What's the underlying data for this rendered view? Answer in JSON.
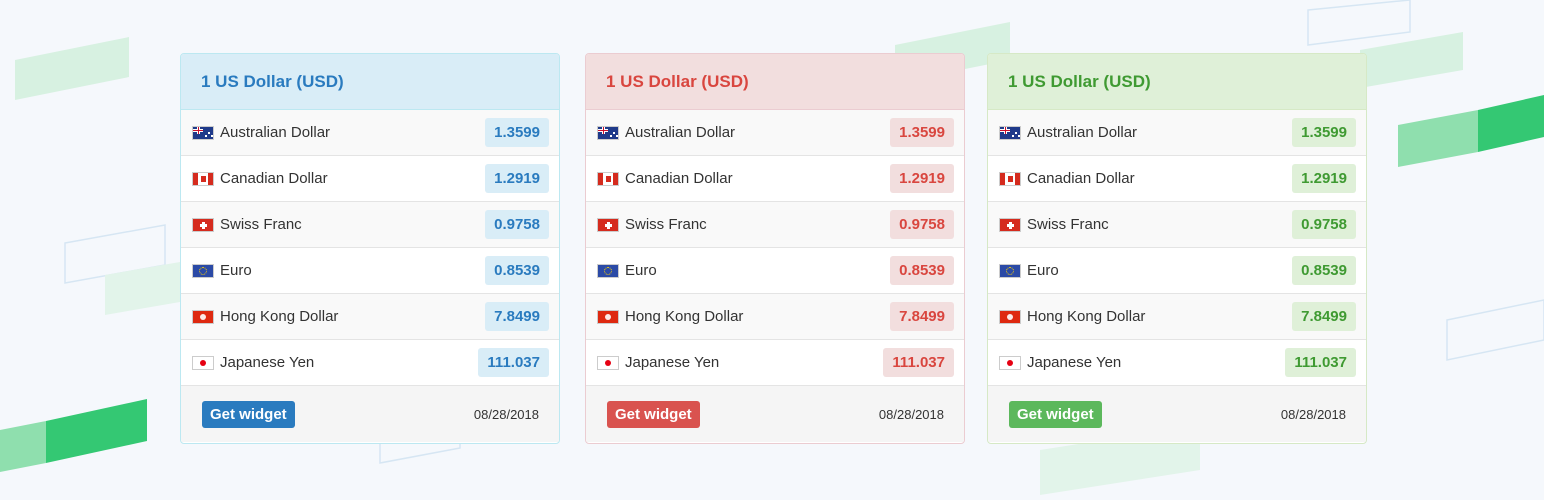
{
  "colors": {
    "blue_accent": "#2a7bbf",
    "red_accent": "#d9534f",
    "green_accent": "#5cb85c"
  },
  "widgets": [
    {
      "theme": "blue",
      "title": "1 US Dollar (USD)",
      "rows": [
        {
          "currency": "Australian Dollar",
          "flag_icon": "australia-flag-icon",
          "rate": "1.3599"
        },
        {
          "currency": "Canadian Dollar",
          "flag_icon": "canada-flag-icon",
          "rate": "1.2919"
        },
        {
          "currency": "Swiss Franc",
          "flag_icon": "switzerland-flag-icon",
          "rate": "0.9758"
        },
        {
          "currency": "Euro",
          "flag_icon": "eu-flag-icon",
          "rate": "0.8539"
        },
        {
          "currency": "Hong Kong Dollar",
          "flag_icon": "hong-kong-flag-icon",
          "rate": "7.8499"
        },
        {
          "currency": "Japanese Yen",
          "flag_icon": "japan-flag-icon",
          "rate": "111.037"
        }
      ],
      "button_label": "Get widget",
      "date": "08/28/2018"
    },
    {
      "theme": "red",
      "title": "1 US Dollar (USD)",
      "rows": [
        {
          "currency": "Australian Dollar",
          "flag_icon": "australia-flag-icon",
          "rate": "1.3599"
        },
        {
          "currency": "Canadian Dollar",
          "flag_icon": "canada-flag-icon",
          "rate": "1.2919"
        },
        {
          "currency": "Swiss Franc",
          "flag_icon": "switzerland-flag-icon",
          "rate": "0.9758"
        },
        {
          "currency": "Euro",
          "flag_icon": "eu-flag-icon",
          "rate": "0.8539"
        },
        {
          "currency": "Hong Kong Dollar",
          "flag_icon": "hong-kong-flag-icon",
          "rate": "7.8499"
        },
        {
          "currency": "Japanese Yen",
          "flag_icon": "japan-flag-icon",
          "rate": "111.037"
        }
      ],
      "button_label": "Get widget",
      "date": "08/28/2018"
    },
    {
      "theme": "green",
      "title": "1 US Dollar (USD)",
      "rows": [
        {
          "currency": "Australian Dollar",
          "flag_icon": "australia-flag-icon",
          "rate": "1.3599"
        },
        {
          "currency": "Canadian Dollar",
          "flag_icon": "canada-flag-icon",
          "rate": "1.2919"
        },
        {
          "currency": "Swiss Franc",
          "flag_icon": "switzerland-flag-icon",
          "rate": "0.9758"
        },
        {
          "currency": "Euro",
          "flag_icon": "eu-flag-icon",
          "rate": "0.8539"
        },
        {
          "currency": "Hong Kong Dollar",
          "flag_icon": "hong-kong-flag-icon",
          "rate": "7.8499"
        },
        {
          "currency": "Japanese Yen",
          "flag_icon": "japan-flag-icon",
          "rate": "111.037"
        }
      ],
      "button_label": "Get widget",
      "date": "08/28/2018"
    }
  ]
}
